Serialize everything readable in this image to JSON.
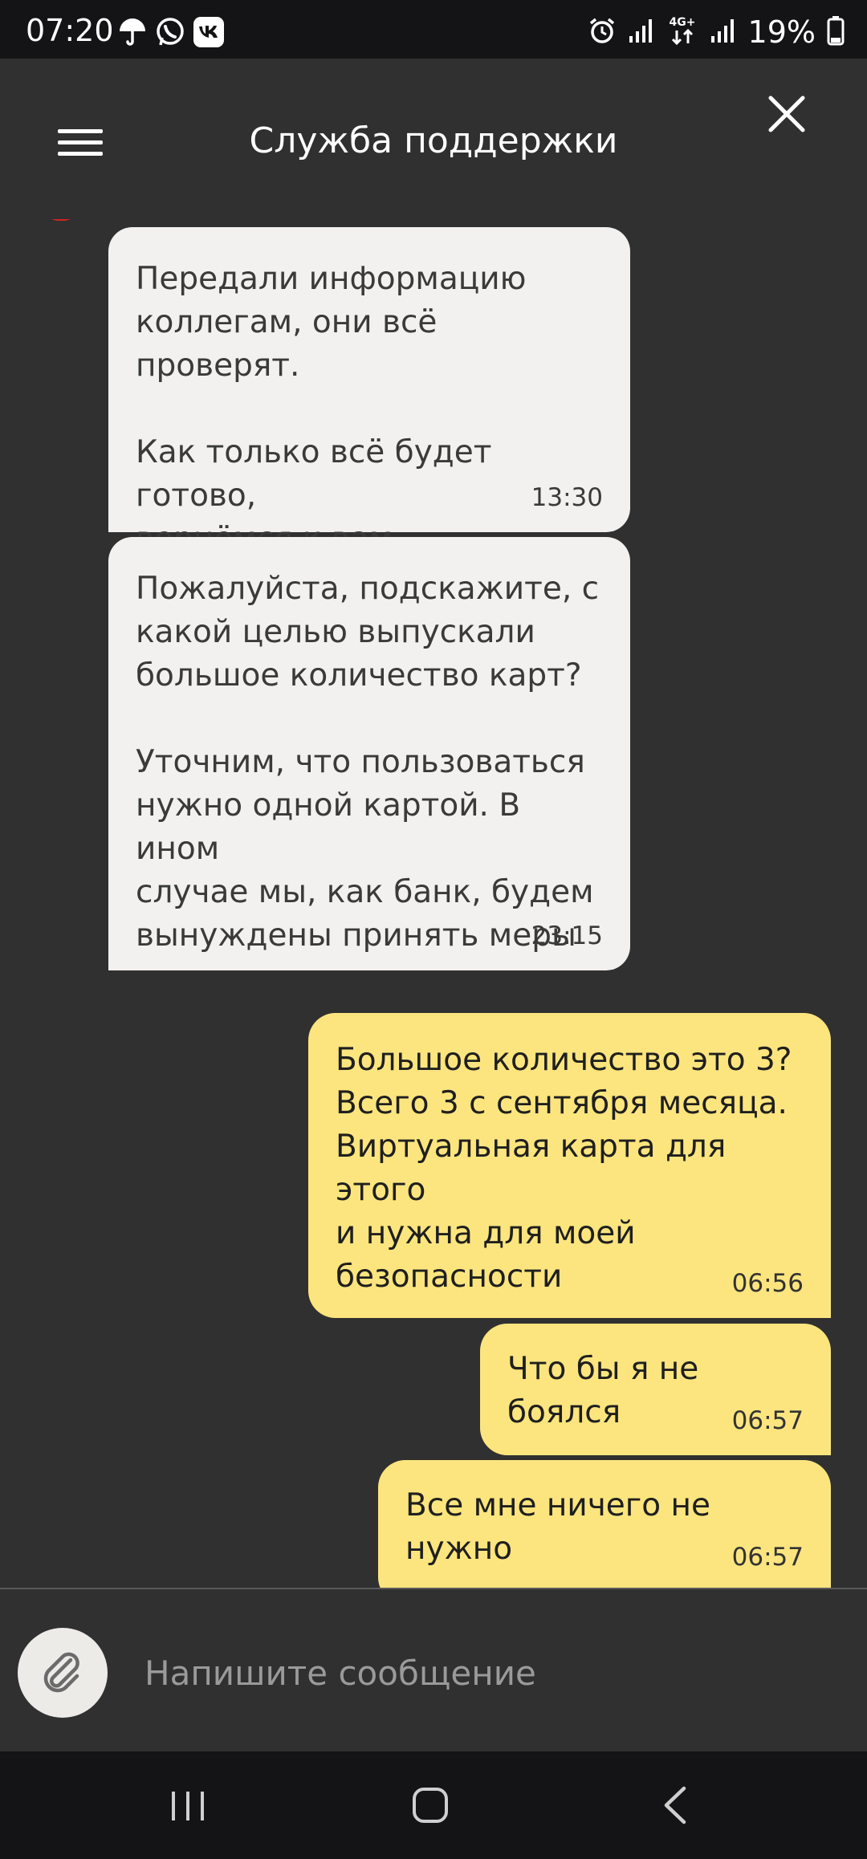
{
  "status_bar": {
    "time": "07:20",
    "battery": "19%",
    "network": "4G+"
  },
  "header": {
    "title": "Служба поддержки"
  },
  "messages": [
    {
      "direction": "in",
      "text": "Передали информацию\nколлегам, они всё проверят.\n\nКак только всё будет готово,\nвернёмся к вам",
      "time": "13:30"
    },
    {
      "direction": "in",
      "text": "Пожалуйста, подскажите, с\nкакой целью выпускали\nбольшое количество карт?\n\nУточним, что пользоваться\nнужно одной картой. В ином\nслучае мы, как банк, будем\nвынуждены принять меры",
      "time": "23:15"
    },
    {
      "direction": "out",
      "text": "Большое количество это 3?\nВсего 3 с сентября месяца.\nВиртуальная карта для этого\nи нужна для моей\nбезопасности",
      "time": "06:56"
    },
    {
      "direction": "out",
      "text": "Что бы я не боялся",
      "time": "06:57"
    },
    {
      "direction": "out",
      "text": "Все мне ничего не нужно",
      "time": "06:57"
    }
  ],
  "composer": {
    "placeholder": "Напишите сообщение"
  },
  "colors": {
    "incoming": "#f2f1ef",
    "outgoing": "#fce57e",
    "background": "#313030",
    "system_bar": "#141416"
  }
}
